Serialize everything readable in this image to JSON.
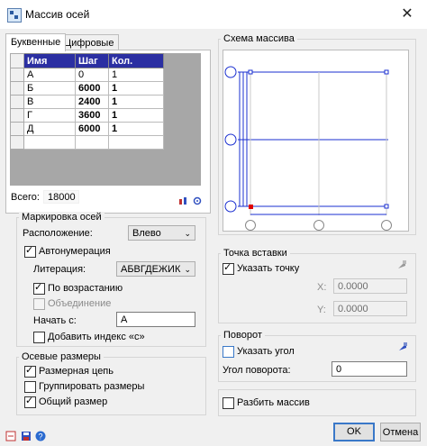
{
  "window": {
    "title": "Массив осей",
    "close_glyph": "✕"
  },
  "tabs": [
    {
      "label": "Буквенные"
    },
    {
      "label": "Цифровые"
    }
  ],
  "table": {
    "headers": [
      "Имя",
      "Шаг",
      "Кол."
    ],
    "rows": [
      [
        "А",
        "0",
        "1"
      ],
      [
        "Б",
        "6000",
        "1"
      ],
      [
        "В",
        "2400",
        "1"
      ],
      [
        "Г",
        "3600",
        "1"
      ],
      [
        "Д",
        "6000",
        "1"
      ]
    ]
  },
  "total": {
    "label": "Всего:",
    "value": "18000"
  },
  "marking": {
    "group_label": "Маркировка осей",
    "location_label": "Расположение:",
    "location_value": "Влево",
    "autonumber_label": "Автонумерация",
    "literation_label": "Литерация:",
    "literation_value": "АБВГДЕЖИК",
    "ascending_label": "По возрастанию",
    "merge_label": "Объединение",
    "start_label": "Начать с:",
    "start_value": "А",
    "add_index_label": "Добавить индекс «с»"
  },
  "dimensions": {
    "group_label": "Осевые размеры",
    "chain_label": "Размерная цепь",
    "group_dims_label": "Группировать размеры",
    "total_label": "Общий размер"
  },
  "preview": {
    "group_label": "Схема массива"
  },
  "insertion": {
    "group_label": "Точка вставки",
    "specify_point_label": "Указать точку",
    "x_label": "X:",
    "x_value": "0.0000",
    "y_label": "Y:",
    "y_value": "0.0000"
  },
  "rotation": {
    "group_label": "Поворот",
    "specify_angle_label": "Указать угол",
    "angle_label": "Угол поворота:",
    "angle_value": "0"
  },
  "explode": {
    "label": "Разбить массив"
  },
  "buttons": {
    "ok": "OK",
    "cancel": "Отмена"
  },
  "colors": {
    "header_blue": "#2b2fa2",
    "preview_blue": "#1a2fd0",
    "marker_red": "#e00000"
  }
}
